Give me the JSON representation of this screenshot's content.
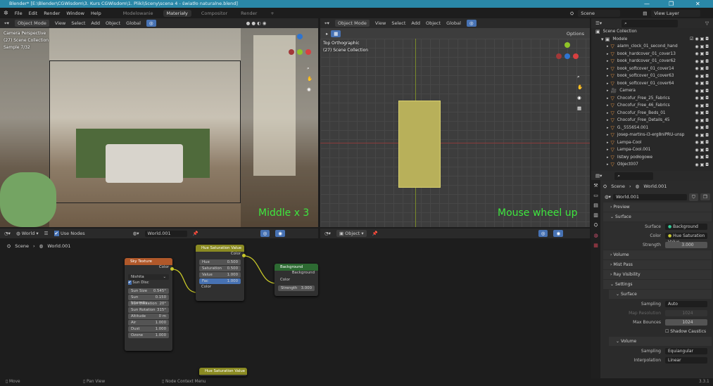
{
  "window": {
    "title": "Blender* [E:\\Blender\\CGWisdom\\3. Kurs CGWisdom\\1. Pliki\\Sceny\\scena 4 - światło naturalne.blend]",
    "minimize": "—",
    "maximize": "❐",
    "close": "✕"
  },
  "menu": [
    "File",
    "Edit",
    "Render",
    "Window",
    "Help"
  ],
  "workspaces": [
    {
      "label": "Modelowanie",
      "active": false
    },
    {
      "label": "Materiały",
      "active": true
    },
    {
      "label": "Compositor",
      "active": false
    },
    {
      "label": "Render",
      "active": false
    },
    {
      "label": "+",
      "active": false
    }
  ],
  "scene_selector": {
    "scene": "Scene",
    "view_layer": "View Layer"
  },
  "viewport_left": {
    "mode": "Object Mode",
    "menus": [
      "View",
      "Select",
      "Add",
      "Object"
    ],
    "orientation": "Global",
    "overlay": [
      "Camera Perspective",
      "(27) Scene Collection",
      "Sample 7/32"
    ],
    "hint": "Middle x 3"
  },
  "viewport_right": {
    "mode": "Object Mode",
    "menus": [
      "View",
      "Select",
      "Add",
      "Object"
    ],
    "orientation": "Global",
    "options": "Options",
    "overlay": [
      "Top Orthographic",
      "(27) Scene Collection"
    ],
    "hint": "Mouse wheel up"
  },
  "outliner": {
    "root": "Scene Collection",
    "collection": "Modele",
    "items": [
      "alarm_clock_01_second_hand",
      "book_hardcover_01_cover13",
      "book_hardcover_01_cover62",
      "book_softcover_01_cover14",
      "book_softcover_01_cover63",
      "book_softcover_01_cover64",
      "Camera",
      "Chocofur_Free_25_Fabrics",
      "Chocofur_Free_46_Fabrics",
      "Chocofur_Free_Beds_01",
      "Chocofur_Free_Details_45",
      "G._555654.001",
      "josep-martins-l3-erg8niPRU-unsp",
      "Lampa-Cool",
      "Lampa-Cool.001",
      "listwy podłogowe",
      "Object007"
    ]
  },
  "properties": {
    "breadcrumb": [
      "Scene",
      "World.001"
    ],
    "world": "World.001",
    "panels": {
      "preview": "Preview",
      "surface": "Surface",
      "volume": "Volume",
      "mist": "Mist Pass",
      "ray": "Ray Visibility",
      "settings": "Settings",
      "sub_surface": "Surface",
      "sub_volume": "Volume"
    },
    "surface": {
      "label": "Surface",
      "value": "Background"
    },
    "color": {
      "label": "Color",
      "value": "Hue Saturation Value"
    },
    "strength": {
      "label": "Strength",
      "value": "3.000"
    },
    "sampling": {
      "label": "Sampling",
      "value": "Auto"
    },
    "map_res": {
      "label": "Map Resolution",
      "value": "1024"
    },
    "max_bounces": {
      "label": "Max Bounces",
      "value": "1024"
    },
    "shadow_caustics": "Shadow Caustics",
    "vol_sampling": {
      "label": "Sampling",
      "value": "Equiangular"
    },
    "interpolation": {
      "label": "Interpolation",
      "value": "Linear"
    }
  },
  "node_editor": {
    "type": "World",
    "use_nodes": "Use Nodes",
    "world": "World.001",
    "breadcrumb": [
      "Scene",
      "World.001"
    ],
    "sky": {
      "title": "Sky Texture",
      "out": "Color",
      "type": "Nishita",
      "sun_disc": "Sun Disc",
      "fields": [
        [
          "Sun Size",
          "0.545°"
        ],
        [
          "Sun Intensity",
          "0.150"
        ],
        [
          "Sun Elevation",
          "20°"
        ],
        [
          "Sun Rotation",
          "315°"
        ],
        [
          "Altitude",
          "0 m"
        ],
        [
          "Air",
          "1.000"
        ],
        [
          "Dust",
          "1.000"
        ],
        [
          "Ozone",
          "1.000"
        ]
      ]
    },
    "hsv": {
      "title": "Hue Saturation Value",
      "out": "Color",
      "in": "Color",
      "fields": [
        [
          "Hue",
          "0.500"
        ],
        [
          "Saturation",
          "0.500"
        ],
        [
          "Value",
          "1.000"
        ],
        [
          "Fac",
          "1.000"
        ]
      ]
    },
    "bg": {
      "title": "Background",
      "out": "Background",
      "in": "Color",
      "strength": [
        "Strength",
        "3.000"
      ]
    },
    "floating": "Hue Saturation Value"
  },
  "empty_editor": {
    "mode": "Object"
  },
  "status": {
    "move": "Move",
    "pan": "Pan View",
    "context": "Node Context Menu",
    "version": "3.3.1"
  }
}
